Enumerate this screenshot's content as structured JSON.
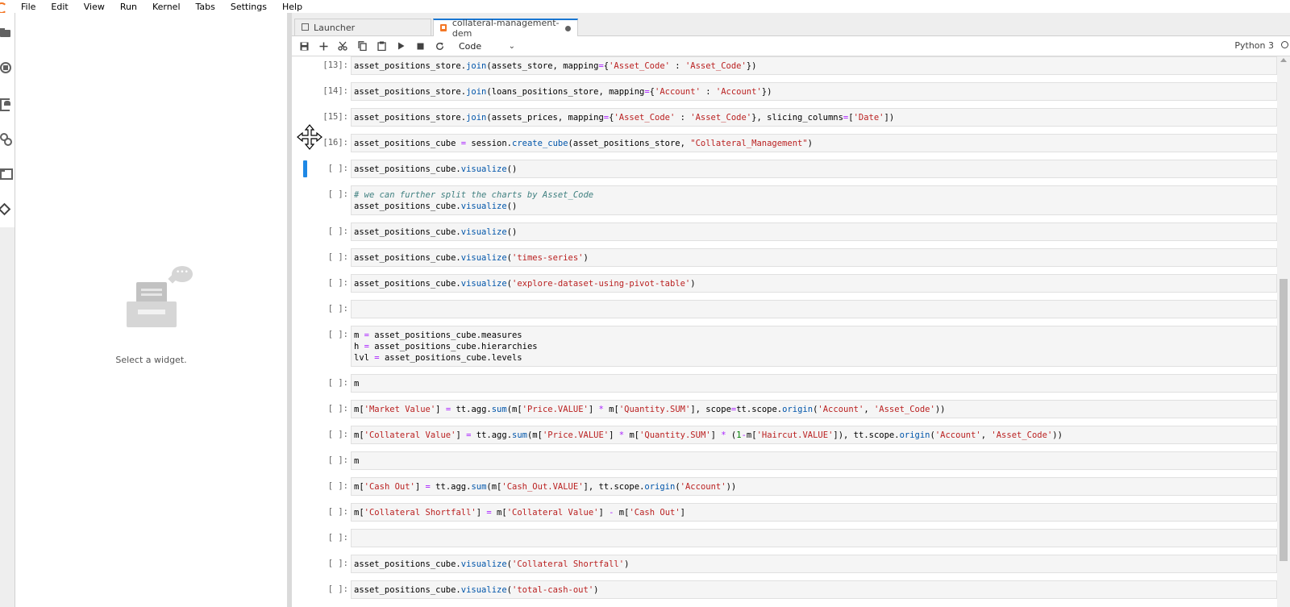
{
  "menu": [
    "File",
    "Edit",
    "View",
    "Run",
    "Kernel",
    "Tabs",
    "Settings",
    "Help"
  ],
  "widget_panel": {
    "empty_text": "Select a widget."
  },
  "tabs": [
    {
      "label": "Launcher",
      "icon": "launcher-icon"
    },
    {
      "label": "collateral-management-dem",
      "icon": "notebook-icon"
    }
  ],
  "toolbar": {
    "buttons": [
      "save-icon",
      "add-icon",
      "cut-icon",
      "copy-icon",
      "paste-icon",
      "run-icon",
      "stop-icon",
      "restart-icon"
    ],
    "cell_type": "Code",
    "kernel": "Python 3"
  },
  "cells": [
    {
      "prompt": "[13]:",
      "code": "asset_positions_store.join(assets_store, mapping={'Asset_Code' : 'Asset_Code'})"
    },
    {
      "prompt": "[14]:",
      "code": "asset_positions_store.join(loans_positions_store, mapping={'Account' : 'Account'})"
    },
    {
      "prompt": "[15]:",
      "code": "asset_positions_store.join(assets_prices, mapping={'Asset_Code' : 'Asset_Code'}, slicing_columns=['Date'])"
    },
    {
      "prompt": "[16]:",
      "code": "asset_positions_cube = session.create_cube(asset_positions_store, \"Collateral_Management\")"
    },
    {
      "prompt": "[ ]:",
      "code": "asset_positions_cube.visualize()"
    },
    {
      "prompt": "[ ]:",
      "code": "# we can further split the charts by Asset_Code\nasset_positions_cube.visualize()"
    },
    {
      "prompt": "[ ]:",
      "code": "asset_positions_cube.visualize()"
    },
    {
      "prompt": "[ ]:",
      "code": "asset_positions_cube.visualize('times-series')"
    },
    {
      "prompt": "[ ]:",
      "code": "asset_positions_cube.visualize('explore-dataset-using-pivot-table')"
    },
    {
      "prompt": "[ ]:",
      "code": ""
    },
    {
      "prompt": "[ ]:",
      "code": "m = asset_positions_cube.measures\nh = asset_positions_cube.hierarchies\nlvl = asset_positions_cube.levels"
    },
    {
      "prompt": "[ ]:",
      "code": "m"
    },
    {
      "prompt": "[ ]:",
      "code": "m['Market Value'] = tt.agg.sum(m['Price.VALUE'] * m['Quantity.SUM'], scope=tt.scope.origin('Account', 'Asset_Code'))"
    },
    {
      "prompt": "[ ]:",
      "code": "m['Collateral Value'] = tt.agg.sum(m['Price.VALUE'] * m['Quantity.SUM'] * (1-m['Haircut.VALUE']), tt.scope.origin('Account', 'Asset_Code'))"
    },
    {
      "prompt": "[ ]:",
      "code": "m"
    },
    {
      "prompt": "[ ]:",
      "code": "m['Cash Out'] = tt.agg.sum(m['Cash_Out.VALUE'], tt.scope.origin('Account'))"
    },
    {
      "prompt": "[ ]:",
      "code": "m['Collateral Shortfall'] = m['Collateral Value'] - m['Cash Out']"
    },
    {
      "prompt": "[ ]:",
      "code": ""
    },
    {
      "prompt": "[ ]:",
      "code": "asset_positions_cube.visualize('Collateral Shortfall')"
    },
    {
      "prompt": "[ ]:",
      "code": "asset_positions_cube.visualize('total-cash-out')"
    }
  ],
  "active_cell_index": 4,
  "colors": {
    "accent": "#1976d2",
    "active_cell": "#1e88e5",
    "string": "#ba2121",
    "function": "#0055aa",
    "operator": "#aa22ff",
    "comment": "#408080"
  }
}
